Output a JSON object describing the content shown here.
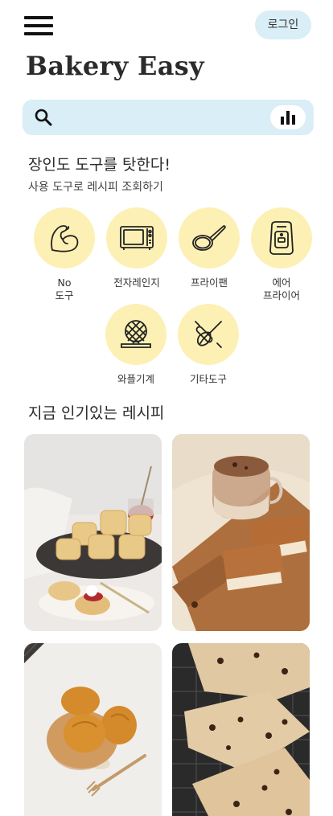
{
  "header": {
    "menu_icon": "hamburger-menu-icon",
    "login_label": "로그인"
  },
  "app": {
    "title": "Bakery Easy"
  },
  "search": {
    "placeholder": "",
    "value": "",
    "search_icon": "search-icon",
    "chart_icon": "bar-chart-icon"
  },
  "tools_section": {
    "title": "장인도 도구를 탓한다!",
    "subtitle": "사용 도구로 레시피 조회하기",
    "items": [
      {
        "label": "No\n도구",
        "icon": "flexed-arm-icon"
      },
      {
        "label": "전자레인지",
        "icon": "microwave-icon"
      },
      {
        "label": "프라이팬",
        "icon": "frying-pan-icon"
      },
      {
        "label": "에어\n프라이어",
        "icon": "air-fryer-icon"
      },
      {
        "label": "와플기계",
        "icon": "waffle-maker-icon"
      },
      {
        "label": "기타도구",
        "icon": "whisk-rolling-pin-icon"
      }
    ]
  },
  "popular_section": {
    "title": "지금 인기있는 레시피",
    "recipes": [
      {
        "image": "scones-with-jam-and-cream-photo"
      },
      {
        "image": "dalgona-coffee-and-lotus-biscuits-photo"
      },
      {
        "image": "madeleines-on-plate-photo"
      },
      {
        "image": "chocolate-chip-scones-photo"
      }
    ]
  },
  "colors": {
    "accent_blue": "#d9eef6",
    "tool_yellow": "#fdf0b4",
    "text": "#2b2b2b"
  }
}
